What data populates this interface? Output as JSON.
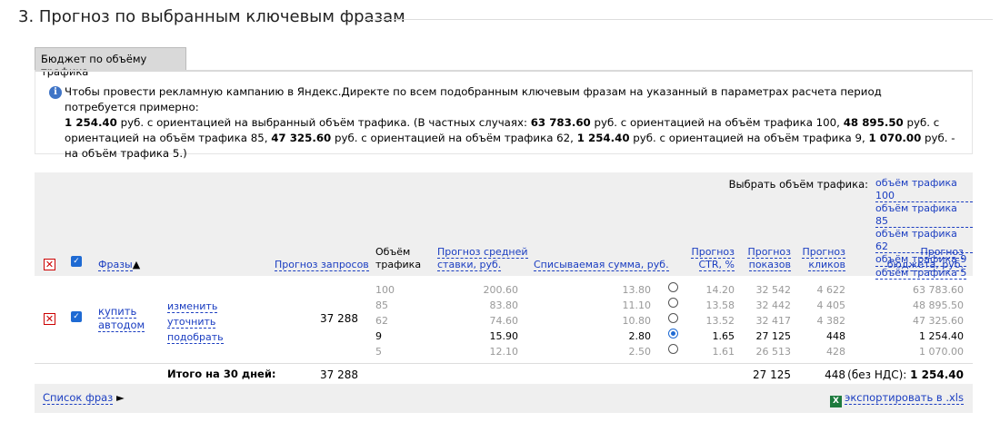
{
  "section_title": "3. Прогноз по выбранным ключевым фразам",
  "tab_label": "Бюджет по объёму трафика",
  "info": {
    "line1": "Чтобы провести рекламную кампанию в Яндекс.Директе по всем подобранным ключевым фразам на указанный в параметрах расчета период потребуется примерно:",
    "main_amount": "1 254.40",
    "main_suffix": " руб. с ориентацией на выбранный объём трафика. (В частных случаях: ",
    "a100": "63 783.60",
    "t100": " руб. с ориентацией на объём трафика 100, ",
    "a85": "48 895.50",
    "t85": " руб. с ориентацией на объём трафика 85, ",
    "a62": "47 325.60",
    "t62": " руб. с ориентацией на объём трафика 62, ",
    "a9": "1 254.40",
    "t9": " руб. с ориентацией на объём трафика 9, ",
    "a5": "1 070.00",
    "t5": " руб. - на объём трафика 5.)"
  },
  "traffic_select": {
    "label": "Выбрать объём трафика:",
    "options": [
      "объём трафика 100",
      "объём трафика 85",
      "объём трафика 62",
      "объём трафика 9",
      "объём трафика 5"
    ]
  },
  "columns": {
    "phrases": "Фразы",
    "sort_icon": "▲",
    "requests": "Прогноз запросов",
    "traffic_l1": "Объём",
    "traffic_l2": "трафика",
    "bid_l1": "Прогноз средней",
    "bid_l2": "ставки, руб.",
    "charged": "Списываемая сумма, руб.",
    "ctr_l1": "Прогноз",
    "ctr_l2": "CTR, %",
    "shows_l1": "Прогноз",
    "shows_l2": "показов",
    "clicks_l1": "Прогноз",
    "clicks_l2": "кликов",
    "budget_l1": "Прогноз",
    "budget_l2": "бюджета, руб."
  },
  "phrase": {
    "text_l1": "купить",
    "text_l2": "автодом",
    "action_edit": "изменить",
    "action_refine": "уточнить",
    "action_pick": "подобрать",
    "requests": "37 288"
  },
  "rows": [
    {
      "traffic": "100",
      "bid": "200.60",
      "charged": "13.80",
      "ctr": "14.20",
      "shows": "32 542",
      "clicks": "4 622",
      "budget": "63 783.60",
      "selected": false
    },
    {
      "traffic": "85",
      "bid": "83.80",
      "charged": "11.10",
      "ctr": "13.58",
      "shows": "32 442",
      "clicks": "4 405",
      "budget": "48 895.50",
      "selected": false
    },
    {
      "traffic": "62",
      "bid": "74.60",
      "charged": "10.80",
      "ctr": "13.52",
      "shows": "32 417",
      "clicks": "4 382",
      "budget": "47 325.60",
      "selected": false
    },
    {
      "traffic": "9",
      "bid": "15.90",
      "charged": "2.80",
      "ctr": "1.65",
      "shows": "27 125",
      "clicks": "448",
      "budget": "1 254.40",
      "selected": true
    },
    {
      "traffic": "5",
      "bid": "12.10",
      "charged": "2.50",
      "ctr": "1.61",
      "shows": "26 513",
      "clicks": "428",
      "budget": "1 070.00",
      "selected": false
    }
  ],
  "total": {
    "label": "Итого на 30 дней:",
    "requests": "37 288",
    "shows": "27 125",
    "clicks": "448",
    "budget_prefix": "(без НДС):",
    "budget": "1 254.40"
  },
  "footer": {
    "phrase_list": "Список фраз",
    "phrase_list_arrow": "►",
    "export": "экспортировать в .xls"
  },
  "colors": {
    "link": "#1a3dc1",
    "grid_bg": "#efefef",
    "info_icon": "#3f74c6",
    "check": "#1e6ad3",
    "delete": "#cc0000"
  }
}
